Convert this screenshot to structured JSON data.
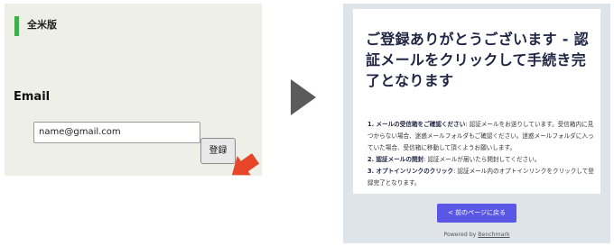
{
  "form": {
    "title": "全米版",
    "email_label": "Email",
    "email_value": "name@gmail.com",
    "submit_label": "登録"
  },
  "confirmation": {
    "heading": "ご登録ありがとうございます - 認証メールをクリックして手続き完了となります",
    "steps": [
      {
        "key": "1. メールの受信箱をご確認ください",
        "text": ": 認証メールをお送りしています。受信箱内に見つからない場合、迷惑メールフォルダもご確認ください。迷惑メールフォルダに入っていた場合、受信箱に移動して頂くようお願いします。"
      },
      {
        "key": "2. 認証メールの開封",
        "text": ": 認証メールが届いたら開封してください。"
      },
      {
        "key": "3. オプトインリンクのクリック",
        "text": ": 認証メール内のオプトインリンクをクリックして登録完了となります。"
      }
    ],
    "back_button": "< 前のページに戻る",
    "powered_prefix": "Powered by ",
    "powered_link": "Benchmark"
  },
  "colors": {
    "accent_green": "#3fae4f",
    "back_button": "#5a56e6",
    "cursor_red": "#e8462a"
  },
  "icons": {
    "cursor": "red-arrow-pointer",
    "transition": "right-play-arrow"
  }
}
